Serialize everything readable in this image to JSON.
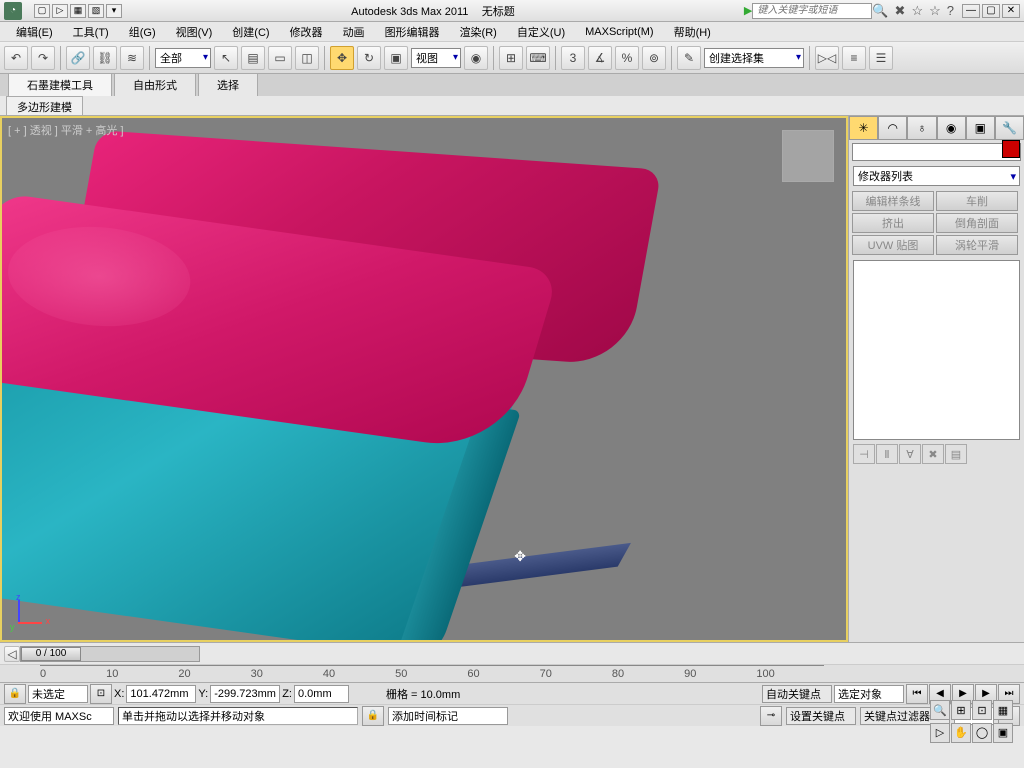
{
  "title": {
    "app": "Autodesk 3ds Max 2011",
    "doc": "无标题",
    "search_placeholder": "键入关键字或短语"
  },
  "menu": [
    "编辑(E)",
    "工具(T)",
    "组(G)",
    "视图(V)",
    "创建(C)",
    "修改器",
    "动画",
    "图形编辑器",
    "渲染(R)",
    "自定义(U)",
    "MAXScript(M)",
    "帮助(H)"
  ],
  "toolbar": {
    "filter": "全部",
    "ref": "视图",
    "selset": "创建选择集"
  },
  "tabs": {
    "main": [
      "石墨建模工具",
      "自由形式",
      "选择"
    ],
    "sub": "多边形建模"
  },
  "viewport": {
    "label": "[ + ] 透视 ] 平滑 + 高光 ]"
  },
  "cmdpanel": {
    "modlist": "修改器列表",
    "buttons": [
      "编辑样条线",
      "车削",
      "挤出",
      "倒角剖面",
      "UVW 贴图",
      "涡轮平滑"
    ]
  },
  "timeline": {
    "pos": "0 / 100",
    "ticks": [
      "0",
      "10",
      "20",
      "30",
      "40",
      "50",
      "60",
      "70",
      "80",
      "90",
      "100"
    ]
  },
  "status": {
    "sel": "未选定",
    "x": "101.472mm",
    "y": "-299.723mm",
    "z": "0.0mm",
    "grid": "栅格 = 10.0mm",
    "autokey": "自动关键点",
    "selobj": "选定对象",
    "setkey": "设置关键点",
    "keyfilter": "关键点过滤器...",
    "welcome": "欢迎使用 MAXSc",
    "hint": "单击并拖动以选择并移动对象",
    "addmarker": "添加时间标记"
  }
}
